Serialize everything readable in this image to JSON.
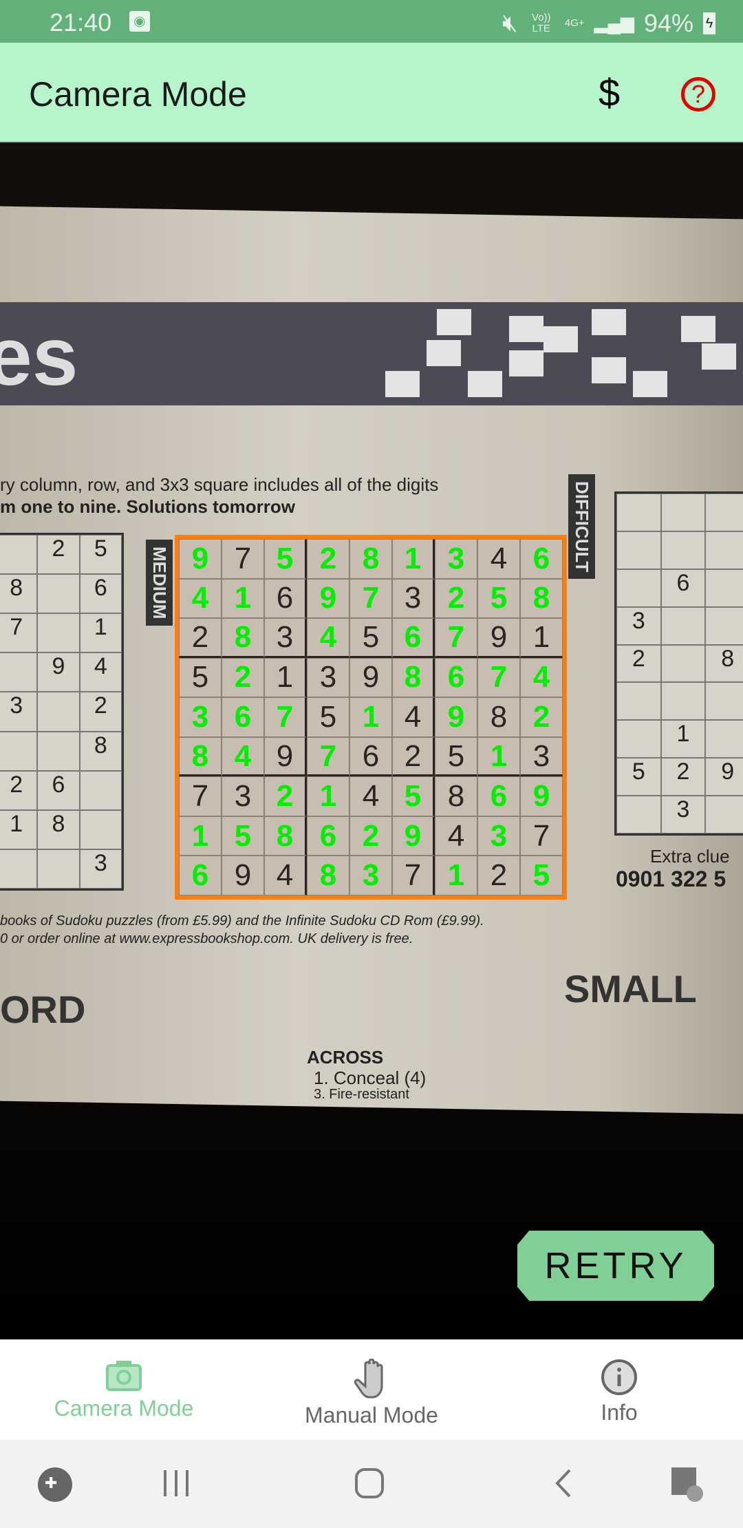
{
  "status_bar": {
    "time": "21:40",
    "volte": "Vo)) LTE",
    "network": "4G+",
    "battery": "94%"
  },
  "app_bar": {
    "title": "Camera Mode",
    "donate_symbol": "$",
    "help_symbol": "?"
  },
  "camera": {
    "scene_text": {
      "instructions_line1": "ry column, row, and 3x3 square includes all of the digits",
      "instructions_line2": "m one to nine. Solutions tomorrow",
      "medium_label": "MEDIUM",
      "difficult_label": "DIFFICULT",
      "books_line1": "books of Sudoku puzzles (from £5.99) and the Infinite Sudoku CD Rom (£9.99).",
      "books_line2": "0 or order online at www.expressbookshop.com. UK delivery is free.",
      "extra_clues": "Extra clue",
      "phone": "0901 322 5",
      "small_heading": "SMALL",
      "ord_heading": "ORD",
      "across": "ACROSS",
      "clue1": "1. Conceal (4)",
      "clue3": "3. Fire-resistant"
    },
    "sudoku": {
      "outline_color": "#ff7f0e",
      "solved_digit_color": "#00ee00",
      "rows": [
        "975281346",
        "416973258",
        "283456791",
        "521398674",
        "367514982",
        "849762513",
        "732145869",
        "158629437",
        "694837125"
      ],
      "printed_mask": [
        "010000010",
        "001001000",
        "101010011",
        "101110000",
        "000101010",
        "001011101",
        "110010100",
        "000000101",
        "011001010"
      ]
    },
    "retry_label": "RETRY"
  },
  "bottom_nav": {
    "items": [
      {
        "label": "Camera Mode",
        "icon": "camera-icon",
        "active": true
      },
      {
        "label": "Manual Mode",
        "icon": "hand-icon",
        "active": false
      },
      {
        "label": "Info",
        "icon": "info-icon",
        "active": false
      }
    ],
    "active_color": "#7fcf96"
  },
  "system_nav": {
    "icons": [
      "game-launcher-icon",
      "recents-icon",
      "home-icon",
      "back-icon",
      "assistant-touch-icon"
    ]
  }
}
